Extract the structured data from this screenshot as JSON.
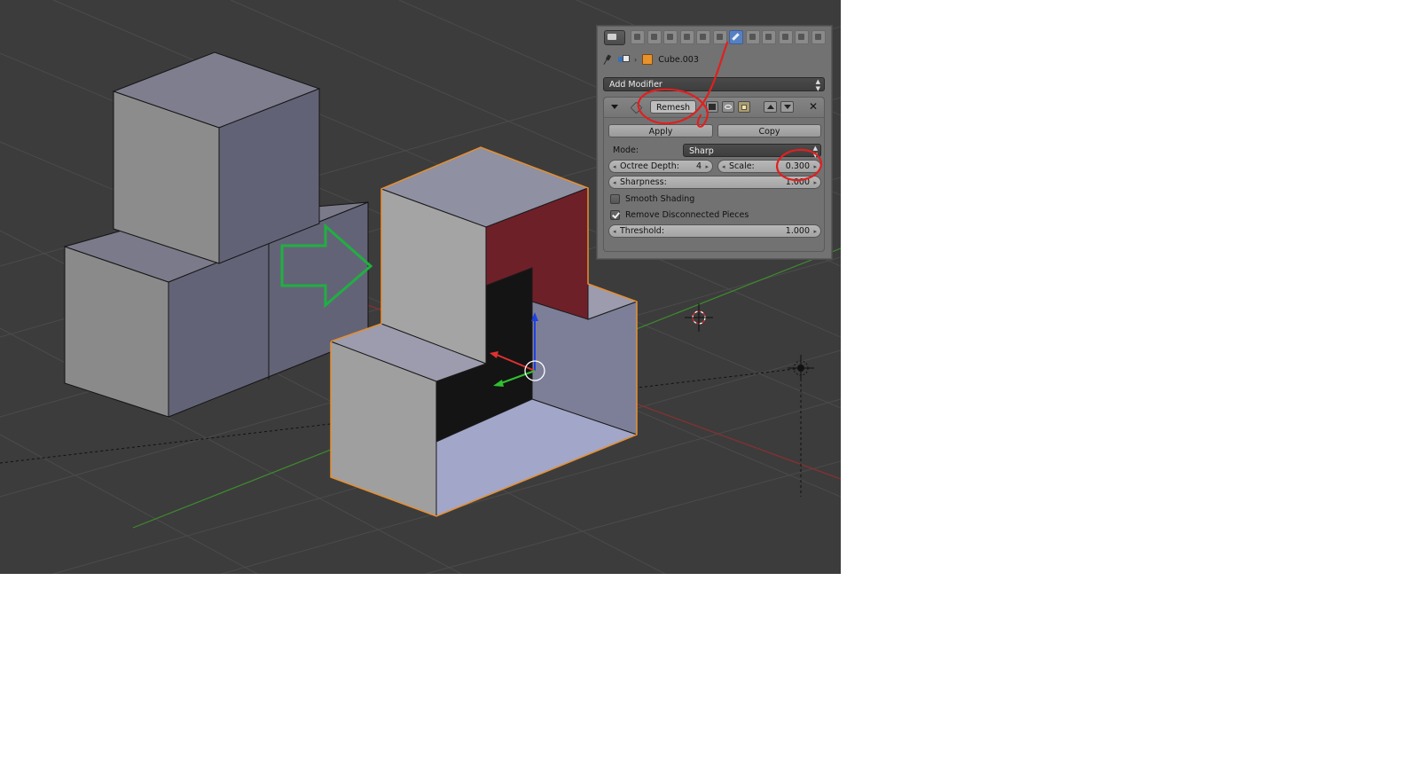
{
  "breadcrumb": {
    "object_name": "Cube.003"
  },
  "add_modifier": {
    "label": "Add Modifier"
  },
  "modifier": {
    "name": "Remesh",
    "apply_label": "Apply",
    "copy_label": "Copy",
    "mode_label": "Mode:",
    "mode_value": "Sharp",
    "octree_depth_label": "Octree Depth:",
    "octree_depth_value": "4",
    "scale_label": "Scale:",
    "scale_value": "0.300",
    "sharpness_label": "Sharpness:",
    "sharpness_value": "1.000",
    "smooth_shading_label": "Smooth Shading",
    "smooth_shading_checked": false,
    "remove_disconnected_label": "Remove Disconnected Pieces",
    "remove_disconnected_checked": true,
    "threshold_label": "Threshold:",
    "threshold_value": "1.000"
  },
  "colors": {
    "viewport_bg": "#3c3c3c",
    "grid_line": "#4a4a4a",
    "x_axis": "#8a3030",
    "y_axis": "#3f8a2f",
    "selection_outline": "#e89030",
    "annotation_red": "#e02020",
    "annotation_green": "#20b040",
    "highlight_face": "#6e2028"
  },
  "icons": [
    "editor-type-icon",
    "render-tab-icon",
    "scene-tab-icon",
    "world-tab-icon",
    "object-tab-icon",
    "constraints-tab-icon",
    "modifiers-tab-icon",
    "data-tab-icon",
    "material-tab-icon",
    "texture-tab-icon",
    "particles-tab-icon",
    "physics-tab-icon",
    "pin-icon",
    "scene-icon",
    "cube-icon",
    "close-icon"
  ]
}
